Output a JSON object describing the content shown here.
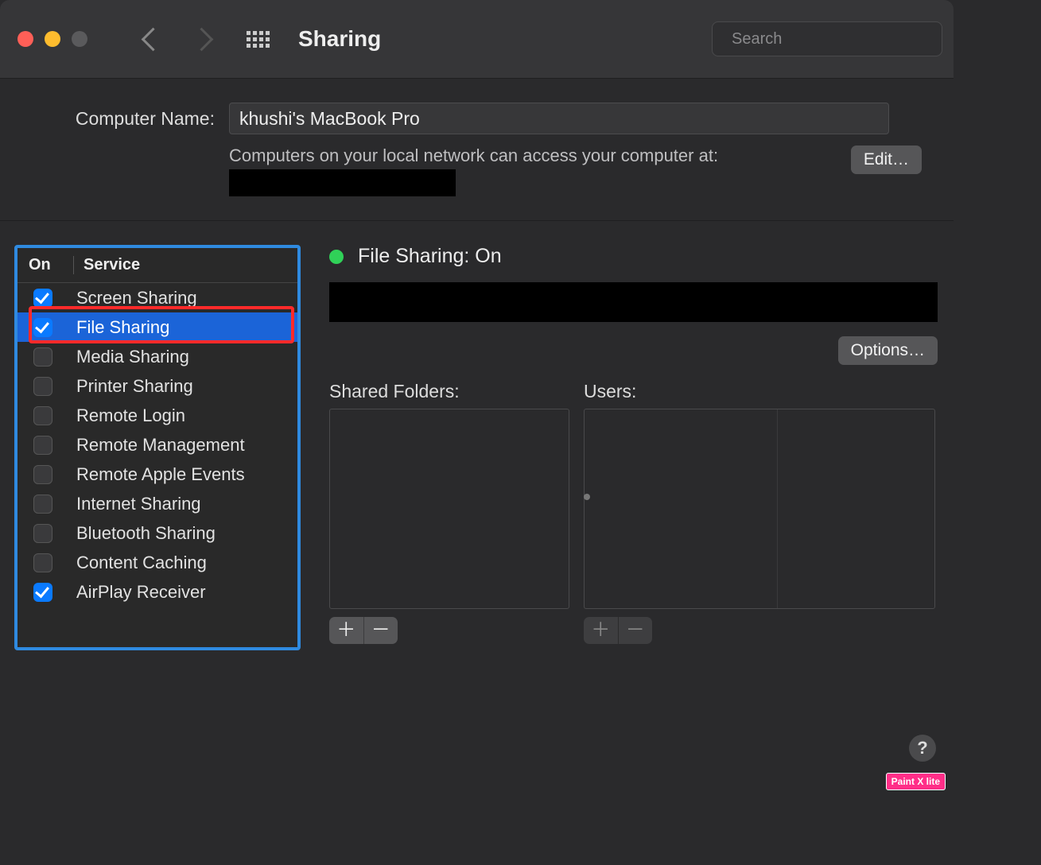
{
  "toolbar": {
    "title": "Sharing",
    "search_placeholder": "Search"
  },
  "header": {
    "computer_name_label": "Computer Name:",
    "computer_name_value": "khushi's MacBook Pro",
    "subtext": "Computers on your local network can access your computer at:",
    "edit_label": "Edit…"
  },
  "services_table": {
    "header_on": "On",
    "header_service": "Service",
    "items": [
      {
        "label": "Screen Sharing",
        "checked": true,
        "selected": false
      },
      {
        "label": "File Sharing",
        "checked": true,
        "selected": true
      },
      {
        "label": "Media Sharing",
        "checked": false,
        "selected": false
      },
      {
        "label": "Printer Sharing",
        "checked": false,
        "selected": false
      },
      {
        "label": "Remote Login",
        "checked": false,
        "selected": false
      },
      {
        "label": "Remote Management",
        "checked": false,
        "selected": false
      },
      {
        "label": "Remote Apple Events",
        "checked": false,
        "selected": false
      },
      {
        "label": "Internet Sharing",
        "checked": false,
        "selected": false
      },
      {
        "label": "Bluetooth Sharing",
        "checked": false,
        "selected": false
      },
      {
        "label": "Content Caching",
        "checked": false,
        "selected": false
      },
      {
        "label": "AirPlay Receiver",
        "checked": true,
        "selected": false
      }
    ]
  },
  "detail": {
    "status_text": "File Sharing: On",
    "options_label": "Options…",
    "shared_folders_label": "Shared Folders:",
    "users_label": "Users:"
  },
  "pm_glyphs": {
    "plus": "＋",
    "minus": "－"
  },
  "help_glyph": "?",
  "watermark": "Paint X lite",
  "colors": {
    "highlight_blue": "#2f8ae0",
    "selection_blue": "#1b64d8",
    "annotation_red": "#ff2a2a",
    "status_green": "#30d158"
  }
}
